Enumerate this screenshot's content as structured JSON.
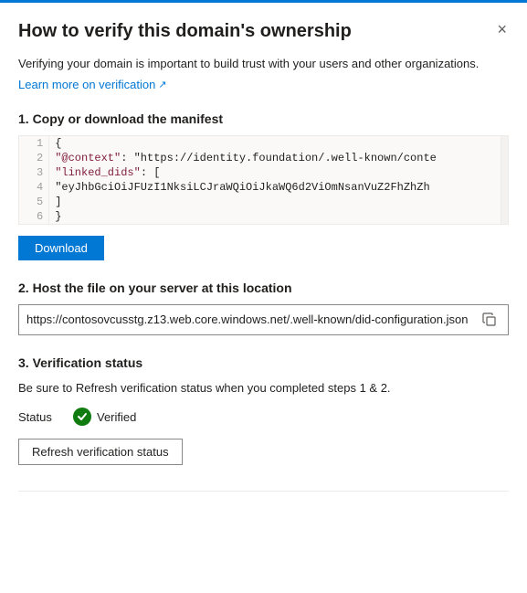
{
  "panel": {
    "title": "How to verify this domain's ownership",
    "close_label": "×"
  },
  "intro": {
    "description": "Verifying your domain is important to build trust with your users and other organizations.",
    "learn_more_label": "Learn more on verification",
    "learn_more_icon": "external-link-icon"
  },
  "step1": {
    "label": "1. Copy or download the manifest",
    "code_lines": [
      {
        "num": "1",
        "content": "{"
      },
      {
        "num": "2",
        "content": "  \"@context\":  \"https://identity.foundation/.well-known/conte"
      },
      {
        "num": "3",
        "content": "  \"linked_dids\": ["
      },
      {
        "num": "4",
        "content": "    \"eyJhbGciOiJFUzI1NksiLCJraWQiOiJkaWQ6d2ViOmNsanVuZ2FhZhZh"
      },
      {
        "num": "5",
        "content": "  ]"
      },
      {
        "num": "6",
        "content": "}"
      }
    ],
    "download_label": "Download"
  },
  "step2": {
    "label": "2. Host the file on your server at this location",
    "url": "https://contosovcusstg.z13.web.core.windows.net/.well-known/did-configuration.json",
    "copy_icon": "copy-icon"
  },
  "step3": {
    "label": "3. Verification status",
    "description": "Be sure to Refresh verification status when you completed steps 1 & 2.",
    "status_label": "Status",
    "verified_text": "Verified",
    "check_icon": "check-icon",
    "refresh_label": "Refresh verification status"
  }
}
